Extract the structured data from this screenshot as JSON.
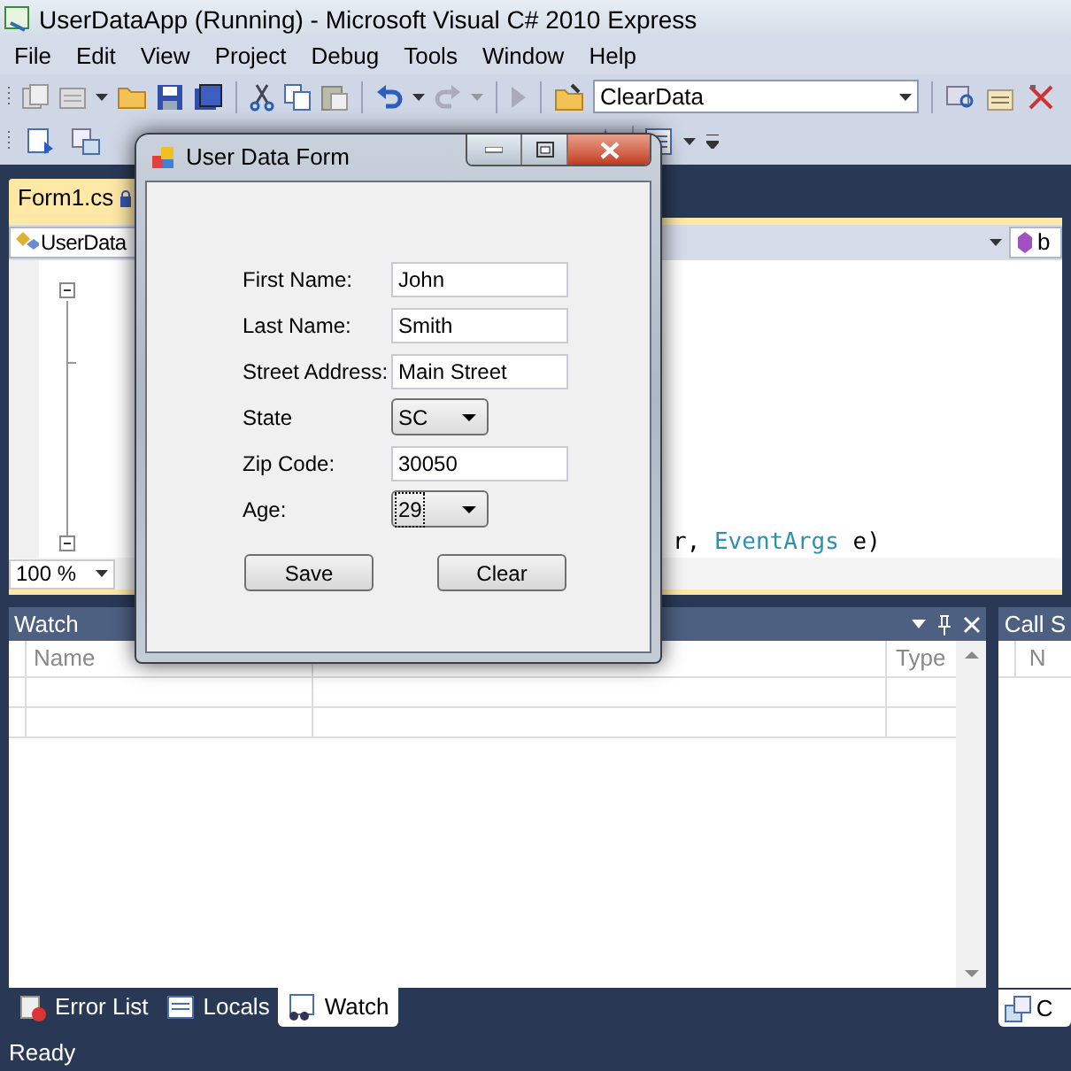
{
  "window": {
    "title": "UserDataApp (Running) - Microsoft Visual C# 2010 Express"
  },
  "menu": [
    {
      "label": "File"
    },
    {
      "label": "Edit"
    },
    {
      "label": "View"
    },
    {
      "label": "Project"
    },
    {
      "label": "Debug"
    },
    {
      "label": "Tools"
    },
    {
      "label": "Window"
    },
    {
      "label": "Help"
    }
  ],
  "toolbar": {
    "solution_config": "ClearData"
  },
  "document_tabs": [
    {
      "label": "Form1.cs",
      "selected": true,
      "locked": true
    }
  ],
  "nav_bar": {
    "type_combo": "UserData",
    "member_combo": "b"
  },
  "code_line": [
    {
      "text": "r, ",
      "kind": "plain"
    },
    {
      "text": "EventArgs",
      "kind": "type"
    },
    {
      "text": " e)",
      "kind": "plain"
    }
  ],
  "zoom": "100 %",
  "watch_panel": {
    "title": "Watch",
    "columns": [
      "Name",
      "Type"
    ]
  },
  "side_panel": {
    "title": "Call S",
    "column": "N",
    "tab": "C"
  },
  "bottom_tabs": [
    {
      "label": "Error List",
      "selected": false
    },
    {
      "label": "Locals",
      "selected": false
    },
    {
      "label": "Watch",
      "selected": true
    }
  ],
  "status_bar": "Ready",
  "dialog": {
    "title": "User Data Form",
    "fields": [
      {
        "label": "First Name:",
        "kind": "text",
        "value": "John"
      },
      {
        "label": "Last Name:",
        "kind": "text",
        "value": "Smith"
      },
      {
        "label": "Street Address:",
        "kind": "text",
        "value": "Main Street"
      },
      {
        "label": "State",
        "kind": "combo",
        "value": "SC",
        "focused": false
      },
      {
        "label": "Zip Code:",
        "kind": "text",
        "value": "30050"
      },
      {
        "label": "Age:",
        "kind": "combo",
        "value": "29",
        "focused": true
      }
    ],
    "buttons": [
      "Save",
      "Clear"
    ]
  }
}
